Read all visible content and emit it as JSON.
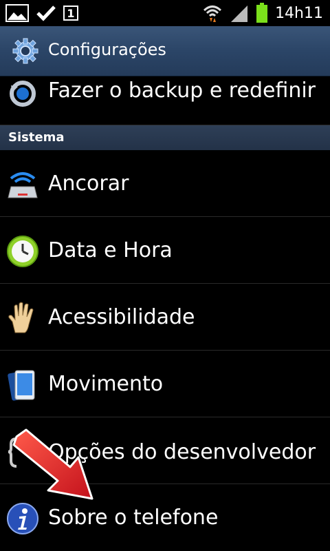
{
  "status_bar": {
    "time": "14h11",
    "sim_label": "1",
    "icons": [
      "gallery-icon",
      "check-icon",
      "sim-card-icon",
      "wifi-icon",
      "signal-icon",
      "battery-icon"
    ],
    "battery_color": "#7be01b"
  },
  "title_bar": {
    "title": "Configurações",
    "icon": "gear-icon",
    "background": "#2b4567"
  },
  "items": [
    {
      "label": "Fazer o backup e redefinir",
      "icon": "backup-reset-icon"
    }
  ],
  "sections": [
    {
      "title": "Sistema",
      "items": [
        {
          "label": "Ancorar",
          "icon": "dock-icon"
        },
        {
          "label": "Data e Hora",
          "icon": "clock-icon"
        },
        {
          "label": "Acessibilidade",
          "icon": "hand-icon"
        },
        {
          "label": "Movimento",
          "icon": "motion-phone-icon"
        },
        {
          "label": "Opções do desenvolvedor",
          "icon": "developer-options-icon"
        },
        {
          "label": "Sobre o telefone",
          "icon": "info-icon"
        }
      ]
    }
  ],
  "annotation": {
    "icon": "red-arrow-icon",
    "color": "#e0242a"
  }
}
